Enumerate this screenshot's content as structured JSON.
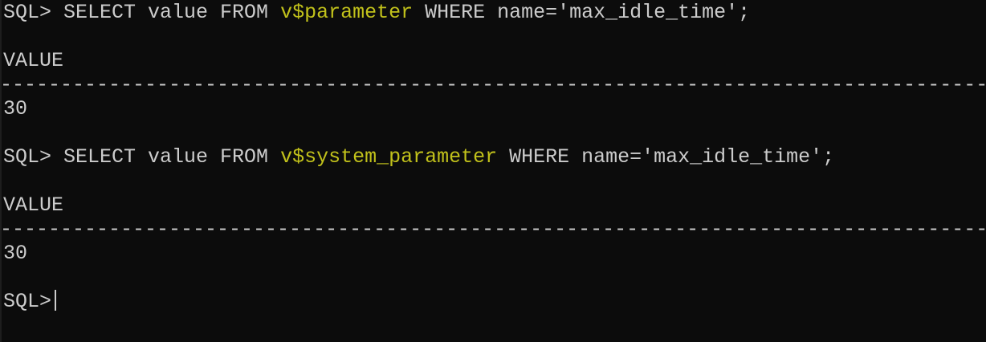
{
  "terminal": {
    "colors": {
      "background": "#0c0c0c",
      "foreground": "#cccccc",
      "highlight": "#c1c11b"
    },
    "prompt": "SQL>",
    "query1": {
      "pre": " SELECT value FROM ",
      "view": "v$parameter",
      "post": " WHERE name='max_idle_time';"
    },
    "result1": {
      "header": "VALUE",
      "separator": "----------------------------------------------------------------------------------------------------------------",
      "value": "30"
    },
    "query2": {
      "pre": " SELECT value FROM ",
      "view": "v$system_parameter",
      "post": " WHERE name='max_idle_time';"
    },
    "result2": {
      "header": "VALUE",
      "separator": "----------------------------------------------------------------------------------------------------------------",
      "value": "30"
    },
    "input": ""
  }
}
